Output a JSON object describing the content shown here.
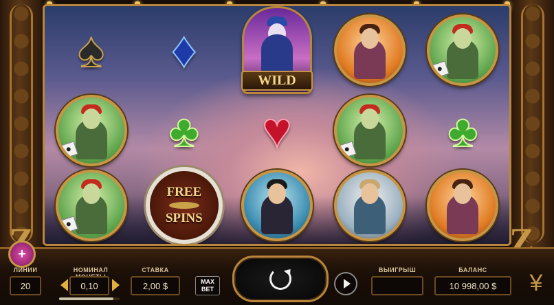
{
  "reels": [
    [
      "spade-symbol",
      "joker-symbol",
      "joker-symbol"
    ],
    [
      "diamond-symbol",
      "club-symbol",
      "free-spins-symbol"
    ],
    [
      "wild-symbol",
      "heart-symbol",
      "gambler-symbol"
    ],
    [
      "pirate-symbol",
      "joker-symbol",
      "poker-player-symbol"
    ],
    [
      "joker-symbol",
      "club-symbol",
      "pirate-symbol"
    ]
  ],
  "wild_label": "WILD",
  "free_spins_label_top": "FREE",
  "free_spins_label_bottom": "SPINS",
  "controls": {
    "lines_label": "ЛИНИИ",
    "lines_value": "20",
    "coin_label": "НОМИНАЛ МОНЕТЫ",
    "coin_value": "0,10",
    "coin_level": 0.9,
    "bet_label": "СТАВКА",
    "bet_value": "2,00 $",
    "maxbet_line1": "MAX",
    "maxbet_line2": "BET",
    "win_label": "ВЫИГРЫШ",
    "win_value": "",
    "balance_label": "БАЛАНС",
    "balance_value": "10 998,00 $",
    "menu_symbol": "+"
  },
  "colors": {
    "frame_gold": "#c59646",
    "accent_pink": "#e04aa8"
  }
}
